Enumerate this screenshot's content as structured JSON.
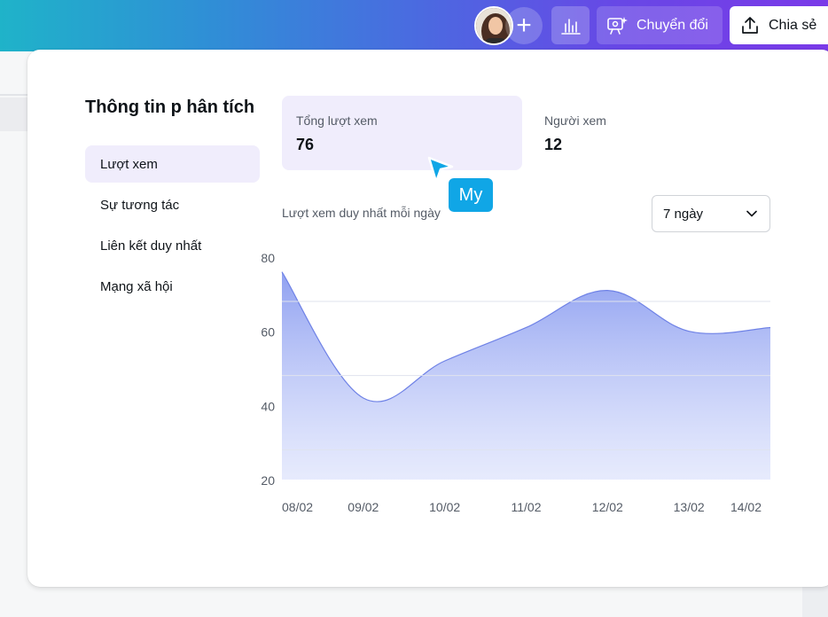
{
  "header": {
    "convert_label": "Chuyển đổi",
    "share_label": "Chia sẻ"
  },
  "insights": {
    "title": "Thông tin p hân tích",
    "nav": [
      {
        "label": "Lượt xem",
        "active": true
      },
      {
        "label": "Sự tương tác",
        "active": false
      },
      {
        "label": "Liên kết duy nhất",
        "active": false
      },
      {
        "label": "Mạng xã hội",
        "active": false
      }
    ],
    "stats": {
      "total_views_label": "Tổng lượt xem",
      "total_views_value": "76",
      "viewers_label": "Người xem",
      "viewers_value": "12"
    },
    "collaborator_cursor": {
      "name": "My",
      "color": "#10a6e6"
    },
    "chart_caption": "Lượt xem duy nhất mỗi ngày",
    "range_select": {
      "selected": "7 ngày"
    }
  },
  "chart_data": {
    "type": "area",
    "x": [
      "08/02",
      "09/02",
      "10/02",
      "11/02",
      "12/02",
      "13/02",
      "14/02"
    ],
    "series": [
      {
        "values": [
          76,
          42,
          52,
          61,
          71,
          60,
          61
        ],
        "color": "#8a9cf0"
      }
    ],
    "yticks": [
      80,
      60,
      40,
      20
    ],
    "ylim": [
      20,
      80
    ],
    "grid": true
  }
}
